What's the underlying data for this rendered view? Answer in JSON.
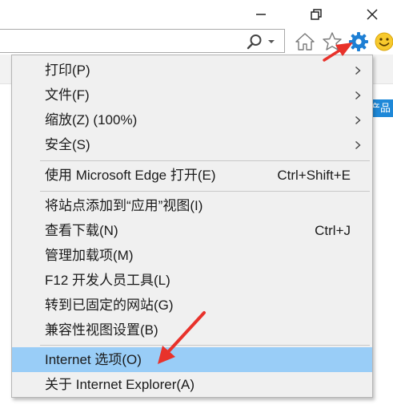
{
  "window": {
    "icons": [
      "minimize-icon",
      "restore-icon",
      "close-icon"
    ]
  },
  "address_bar": {
    "value": "",
    "icons": [
      "search-icon",
      "dropdown-arrow-icon"
    ]
  },
  "toolbar": {
    "icons": [
      "home-icon",
      "favorites-star-icon",
      "tools-gear-icon",
      "feedback-smiley-icon"
    ]
  },
  "background": {
    "partial_tab_label": "产品"
  },
  "menu": {
    "items": [
      {
        "label": "打印(P)",
        "shortcut": "",
        "submenu": true
      },
      {
        "label": "文件(F)",
        "shortcut": "",
        "submenu": true
      },
      {
        "label": "缩放(Z) (100%)",
        "shortcut": "",
        "submenu": true
      },
      {
        "label": "安全(S)",
        "shortcut": "",
        "submenu": true
      },
      {
        "label": "使用 Microsoft Edge 打开(E)",
        "shortcut": "Ctrl+Shift+E",
        "submenu": false
      },
      {
        "label": "将站点添加到“应用”视图(I)",
        "shortcut": "",
        "submenu": false
      },
      {
        "label": "查看下载(N)",
        "shortcut": "Ctrl+J",
        "submenu": false
      },
      {
        "label": "管理加载项(M)",
        "shortcut": "",
        "submenu": false
      },
      {
        "label": "F12 开发人员工具(L)",
        "shortcut": "",
        "submenu": false
      },
      {
        "label": "转到已固定的网站(G)",
        "shortcut": "",
        "submenu": false
      },
      {
        "label": "兼容性视图设置(B)",
        "shortcut": "",
        "submenu": false
      },
      {
        "label": "Internet 选项(O)",
        "shortcut": "",
        "submenu": false,
        "highlighted": true
      },
      {
        "label": "关于 Internet Explorer(A)",
        "shortcut": "",
        "submenu": false
      }
    ]
  },
  "colors": {
    "highlight": "#99cdf7",
    "menu_bg": "#f0f0f0",
    "annotation": "#e8322b",
    "gear_blue": "#1e7fd4",
    "tab_blue": "#1e88d8"
  }
}
